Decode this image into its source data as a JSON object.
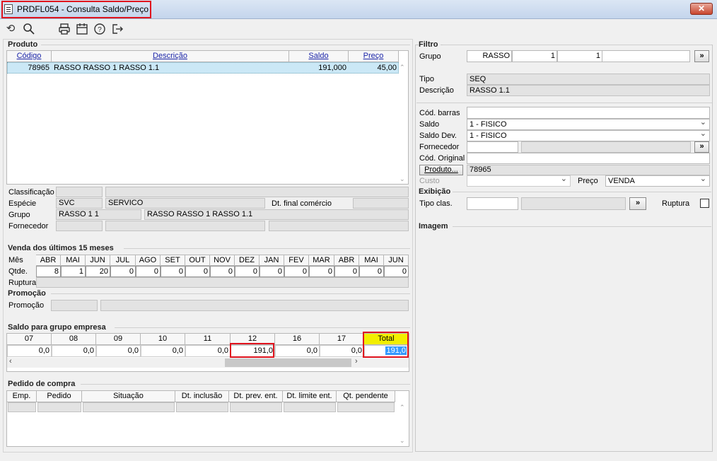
{
  "window": {
    "title": "PRDFL054 - Consulta Saldo/Preço",
    "close": "✕"
  },
  "toolbar": {
    "icons": [
      "refresh-icon",
      "search-icon",
      "print-icon",
      "calendar-icon",
      "help-icon",
      "exit-icon"
    ]
  },
  "produto": {
    "title": "Produto",
    "headers": {
      "codigo": "Código",
      "descricao": "Descrição",
      "saldo": "Saldo",
      "preco": "Preço"
    },
    "rows": [
      {
        "codigo": "78965",
        "descricao": "RASSO RASSO 1 RASSO 1.1",
        "saldo": "191,000",
        "preco": "45,00"
      }
    ],
    "classificacao_label": "Classificação",
    "especie_label": "Espécie",
    "especie_code": "SVC",
    "especie_desc": "SERVICO",
    "dt_final_label": "Dt. final comércio",
    "grupo_label": "Grupo",
    "grupo_code": "RASSO 1 1",
    "grupo_desc": "RASSO RASSO 1 RASSO 1.1",
    "fornecedor_label": "Fornecedor"
  },
  "vendas": {
    "title": "Venda dos últimos 15 meses",
    "mes_label": "Mês",
    "qtde_label": "Qtde.",
    "ruptura_label": "Ruptura",
    "months": [
      "ABR",
      "MAI",
      "JUN",
      "JUL",
      "AGO",
      "SET",
      "OUT",
      "NOV",
      "DEZ",
      "JAN",
      "FEV",
      "MAR",
      "ABR",
      "MAI",
      "JUN"
    ],
    "qty": [
      "8",
      "1",
      "20",
      "0",
      "0",
      "0",
      "0",
      "0",
      "0",
      "0",
      "0",
      "0",
      "0",
      "0",
      "0"
    ]
  },
  "promocao": {
    "title": "Promoção",
    "label": "Promoção"
  },
  "saldo_grupo": {
    "title": "Saldo para grupo empresa",
    "headers": [
      "07",
      "08",
      "09",
      "10",
      "11",
      "12",
      "16",
      "17",
      "Total"
    ],
    "values": [
      "0,0",
      "0,0",
      "0,0",
      "0,0",
      "0,0",
      "191,0",
      "0,0",
      "0,0",
      "191,0"
    ]
  },
  "pedido": {
    "title": "Pedido de compra",
    "headers": [
      "Emp.",
      "Pedido",
      "Situação",
      "Dt. inclusão",
      "Dt. prev. ent.",
      "Dt. limite ent.",
      "Qt. pendente"
    ]
  },
  "filtro": {
    "title": "Filtro",
    "grupo_label": "Grupo",
    "grupo_v1": "RASSO",
    "grupo_v2": "1",
    "grupo_v3": "1",
    "more": "»",
    "tipo_label": "Tipo",
    "tipo_value": "SEQ",
    "descricao_label": "Descrição",
    "descricao_value": "RASSO 1.1",
    "cod_barras_label": "Cód. barras",
    "saldo_label": "Saldo",
    "saldo_value": "1 - FISICO",
    "saldo_dev_label": "Saldo Dev.",
    "saldo_dev_value": "1 - FISICO",
    "fornecedor_label": "Fornecedor",
    "cod_original_label": "Cód. Original",
    "produto_btn": "Produto...",
    "produto_value": "78965",
    "custo_label": "Custo",
    "preco_label": "Preço",
    "preco_value": "VENDA"
  },
  "exibicao": {
    "title": "Exibição",
    "tipo_clas_label": "Tipo clas.",
    "more": "»",
    "ruptura_label": "Ruptura"
  },
  "imagem": {
    "title": "Imagem"
  },
  "colors": {
    "highlight": "#e0141e",
    "total_header": "#f2ee00",
    "selected_cell": "#3399ff"
  }
}
